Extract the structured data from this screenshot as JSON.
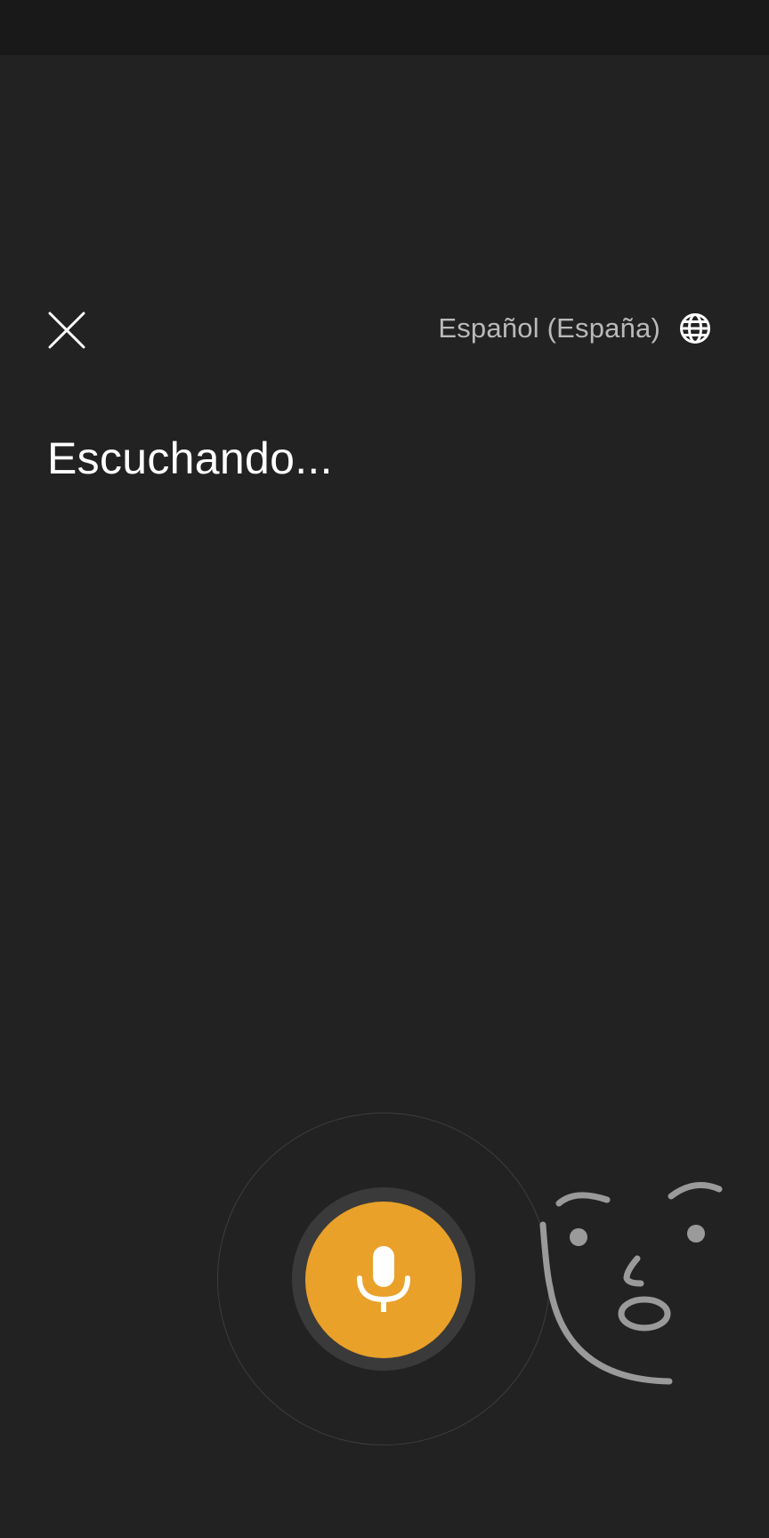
{
  "header": {
    "close_icon": "close-icon",
    "language": {
      "label": "Español (España)",
      "icon": "globe-icon"
    }
  },
  "main": {
    "status_text": "Escuchando..."
  },
  "voice": {
    "mic_icon": "microphone-icon",
    "face_icon": "face-illustration",
    "colors": {
      "background": "#222222",
      "status_bar": "#191919",
      "mic_button": "#e9a129",
      "label": "#b9b9b9",
      "face_line": "#9a9a9a"
    }
  }
}
